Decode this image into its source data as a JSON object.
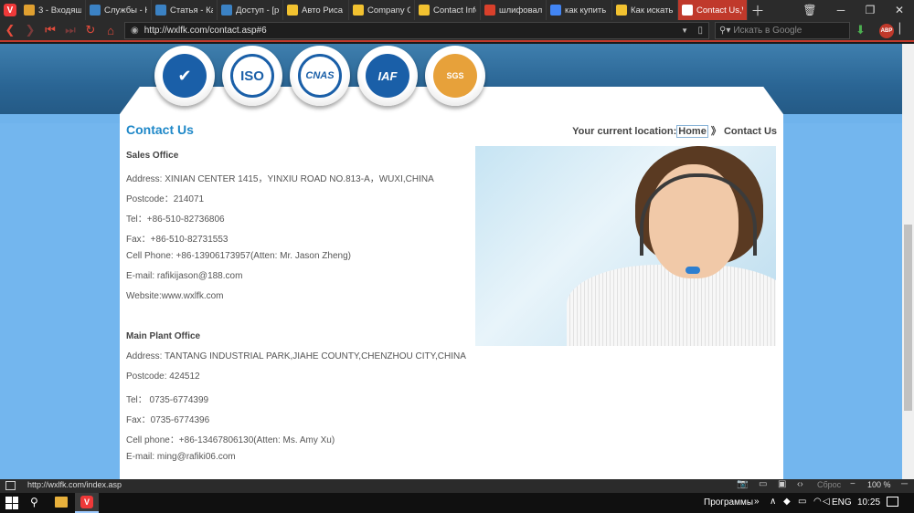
{
  "browser": {
    "tabs": [
      {
        "label": "3 - Входящи",
        "color": "#e0a030"
      },
      {
        "label": "Службы - Ка",
        "color": "#3b82c4"
      },
      {
        "label": "Статья - Кан",
        "color": "#3b82c4"
      },
      {
        "label": "Доступ - [ре",
        "color": "#3b82c4"
      },
      {
        "label": "Авто Риса О",
        "color": "#f2c230"
      },
      {
        "label": "Company Ov",
        "color": "#f2c230"
      },
      {
        "label": "Contact Infor",
        "color": "#f2c230"
      },
      {
        "label": "шлифовальн",
        "color": "#d9402b"
      },
      {
        "label": "как купить н",
        "color": "#4285f4"
      },
      {
        "label": "Как искать,",
        "color": "#f2c230"
      },
      {
        "label": "Contact Us,W",
        "color": "#ffffff"
      }
    ],
    "url": "http://wxlfk.com/contact.asp#6",
    "search_placeholder": "Искать в Google",
    "abp_label": "ABP",
    "status_url": "http://wxlfk.com/index.asp",
    "reset_label": "Сброс",
    "zoom_label": "100 %"
  },
  "page": {
    "title": "Contact Us",
    "breadcrumb": {
      "prefix": "Your current location:",
      "home": "Home",
      "separator": "》",
      "current": "Contact Us"
    },
    "certs": [
      "ISO",
      "CNAS",
      "IAF",
      "SGS"
    ],
    "sales": {
      "heading": "Sales Office",
      "address": "Address: XINIAN CENTER 1415，YINXIU ROAD NO.813-A，WUXI,CHINA",
      "postcode": "Postcode：214071",
      "tel": "Tel：+86-510-82736806",
      "fax": "Fax：+86-510-82731553",
      "cell": "Cell Phone: +86-13906173957(Atten: Mr. Jason Zheng)",
      "email": "E-mail: rafikijason@188.com",
      "website": "Website:www.wxlfk.com"
    },
    "plant": {
      "heading": "Main Plant Office",
      "address": "Address: TANTANG INDUSTRIAL PARK,JIAHE COUNTY,CHENZHOU CITY,CHINA",
      "postcode": "Postcode: 424512",
      "tel": "Tel： 0735-6774399",
      "fax": "Fax：0735-6774396",
      "cell": "Cell phone：+86-13467806130(Atten: Ms. Amy Xu)",
      "email": "E-mail: ming@rafiki06.com"
    }
  },
  "taskbar": {
    "programs_label": "Программы",
    "lang": "ENG",
    "time": "10:25"
  },
  "colors": {
    "accent": "#c0392b",
    "title_blue": "#1f88c8",
    "page_bg": "#73b6ee"
  }
}
